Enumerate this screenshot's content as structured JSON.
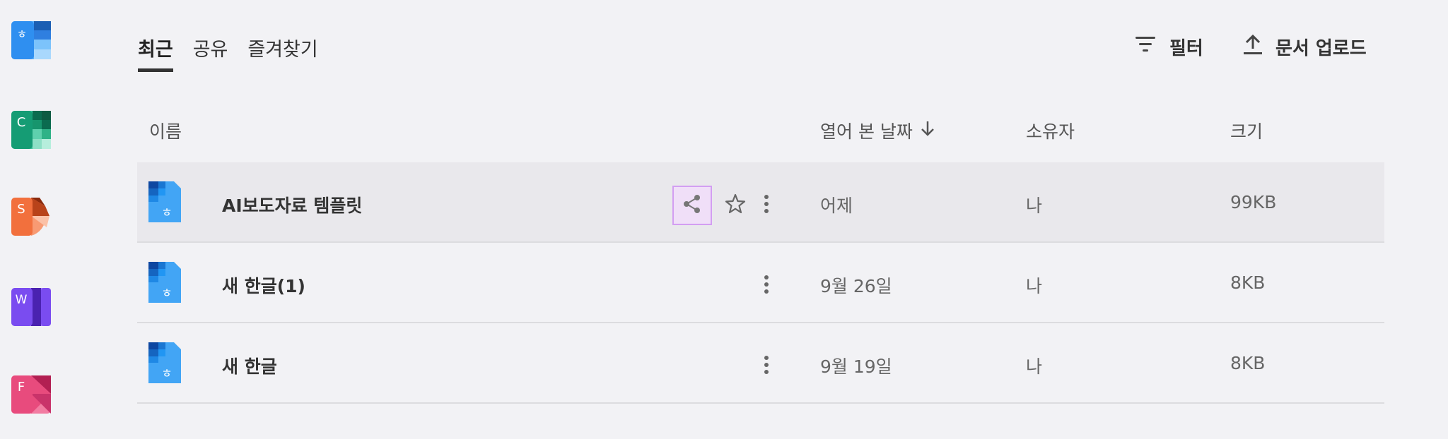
{
  "sidebar": {
    "apps": [
      {
        "name": "hangul",
        "letter": "ㅎ",
        "colors": [
          "#2f8ff0",
          "#5cb0fa",
          "#1c5fb3"
        ]
      },
      {
        "name": "cell",
        "letter": "C",
        "colors": [
          "#159c74",
          "#3cc29a",
          "#0b6b4f"
        ]
      },
      {
        "name": "show",
        "letter": "S",
        "colors": [
          "#f2703d",
          "#f89a73",
          "#b8431a"
        ]
      },
      {
        "name": "word",
        "letter": "W",
        "colors": [
          "#7a4cf0",
          "#9f7bf7",
          "#4a22b0"
        ]
      },
      {
        "name": "pdf",
        "letter": "F",
        "colors": [
          "#e84b7d",
          "#f27ca2",
          "#b21f52"
        ]
      }
    ]
  },
  "tabs": [
    {
      "label": "최근",
      "active": true
    },
    {
      "label": "공유",
      "active": false
    },
    {
      "label": "즐겨찾기",
      "active": false
    }
  ],
  "actions": {
    "filter_label": "필터",
    "upload_label": "문서 업로드"
  },
  "table": {
    "headers": {
      "name": "이름",
      "date": "열어 본 날짜",
      "owner": "소유자",
      "size": "크기"
    },
    "rows": [
      {
        "name": "AI보도자료 템플릿",
        "date": "어제",
        "owner": "나",
        "size": "99KB"
      },
      {
        "name": "새 한글(1)",
        "date": "9월 26일",
        "owner": "나",
        "size": "8KB"
      },
      {
        "name": "새 한글",
        "date": "9월 19일",
        "owner": "나",
        "size": "8KB"
      }
    ]
  },
  "colors": {
    "file_icon": "#42a5f5",
    "file_icon_dark": "#1565c0",
    "share_highlight": "#d39ef2"
  }
}
